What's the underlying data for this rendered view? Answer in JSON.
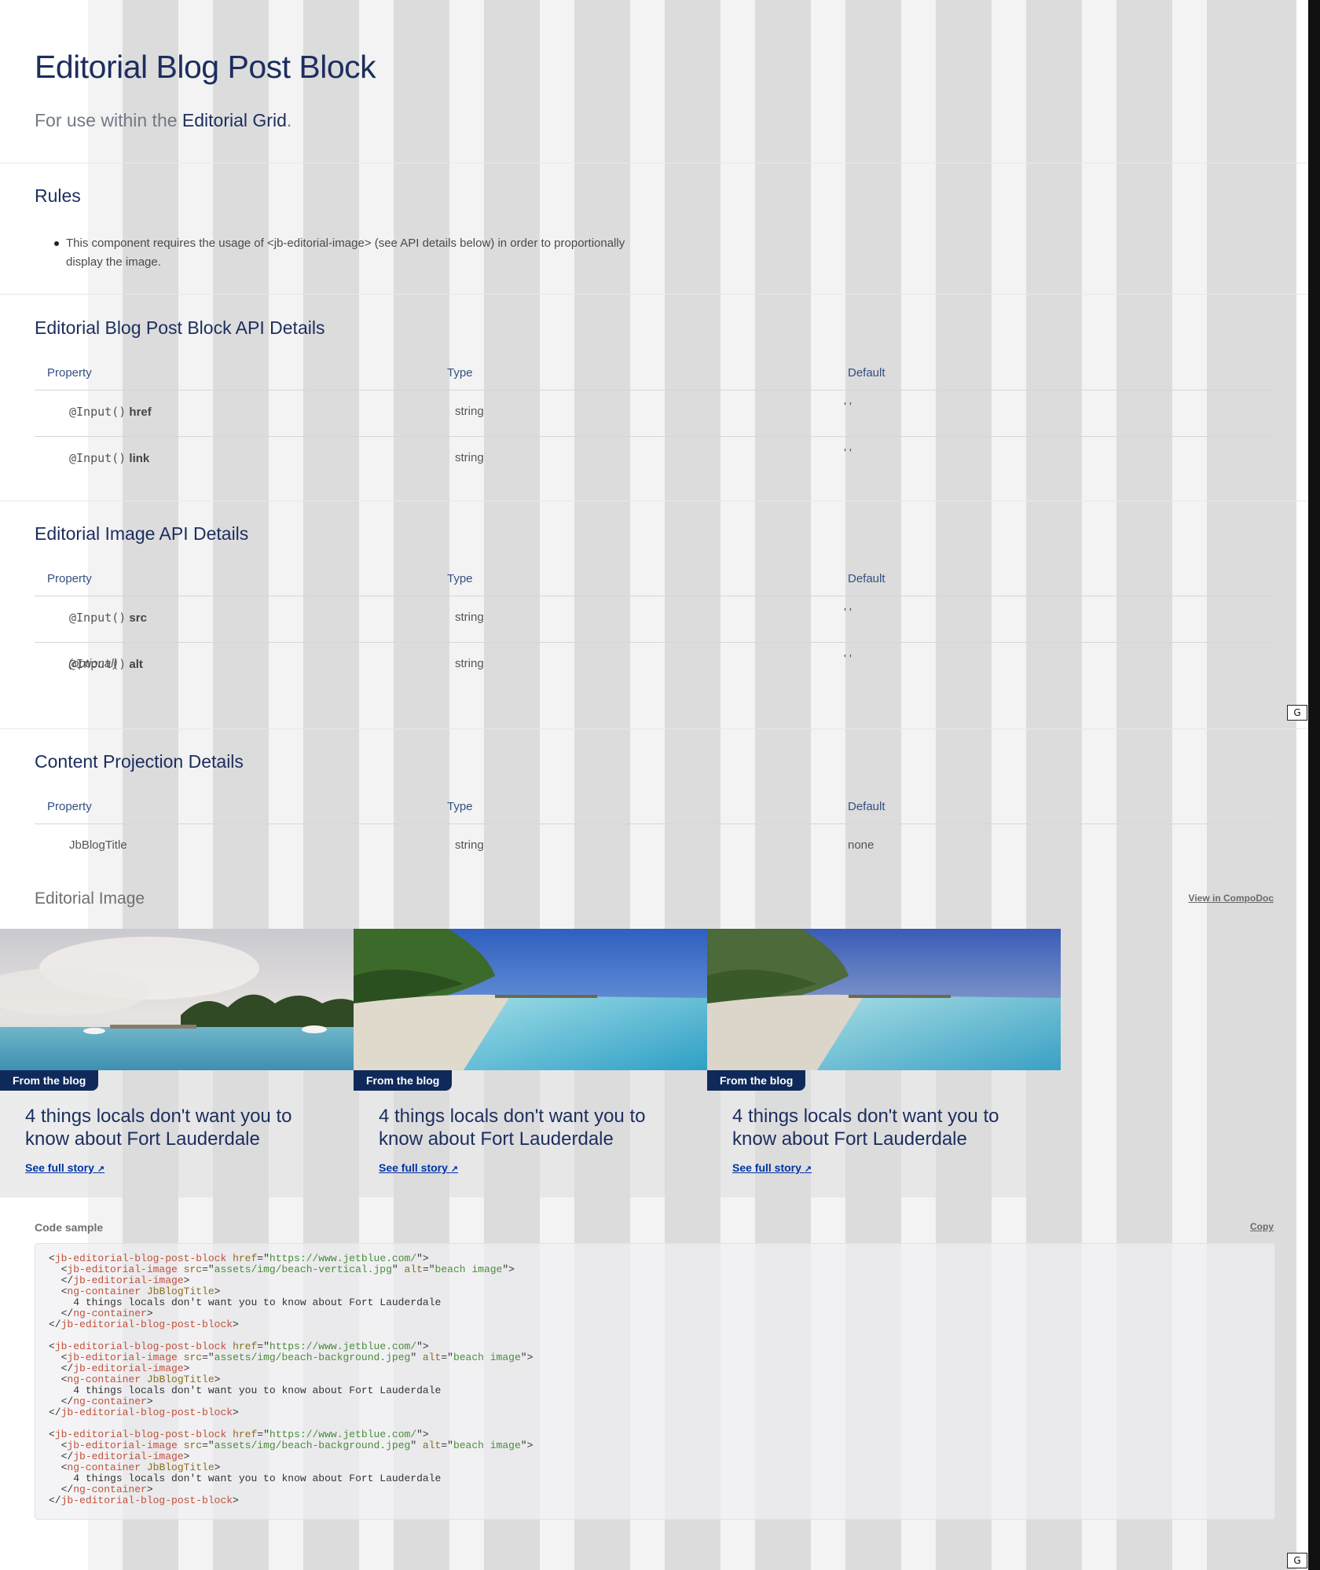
{
  "page": {
    "title": "Editorial Blog Post Block",
    "subtitle_prefix": "For use within the ",
    "subtitle_link": "Editorial Grid",
    "subtitle_suffix": "."
  },
  "rules": {
    "heading": "Rules",
    "items": [
      "This component requires the usage of <jb-editorial-image> (see API details below) in order to proportionally display the image."
    ]
  },
  "table_headers": {
    "property": "Property",
    "type": "Type",
    "default": "Default"
  },
  "blog_api": {
    "heading": "Editorial Blog Post Block API Details",
    "rows": [
      {
        "decorator": "@Input()",
        "name": "href",
        "type": "string",
        "default": "' '"
      },
      {
        "decorator": "@Input()",
        "name": "link",
        "type": "string",
        "default": "' '"
      }
    ]
  },
  "image_api": {
    "heading": "Editorial Image API Details",
    "rows": [
      {
        "decorator": "@Input()",
        "name": "src",
        "type": "string",
        "default": "' '"
      },
      {
        "decorator": "@Input()",
        "name": "alt",
        "note": "(optional)",
        "type": "string",
        "default": "' '"
      }
    ]
  },
  "content_projection": {
    "heading": "Content Projection Details",
    "rows": [
      {
        "name": "JbBlogTitle",
        "type": "string",
        "default": "none"
      }
    ]
  },
  "example": {
    "title": "Editorial Image",
    "compodoc_link": "View in CompoDoc",
    "cards": [
      {
        "badge": "From the blog",
        "title": "4 things locals don't want you to know about Fort Lauderdale",
        "link": "See full story",
        "link_icon": "↗",
        "image": "beach-vertical"
      },
      {
        "badge": "From the blog",
        "title": "4 things locals don't want you to know about Fort Lauderdale",
        "link": "See full story",
        "link_icon": "↗",
        "image": "beach-background"
      },
      {
        "badge": "From the blog",
        "title": "4 things locals don't want you to know about Fort Lauderdale",
        "link": "See full story",
        "link_icon": "↗",
        "image": "beach-background"
      }
    ]
  },
  "code_sample": {
    "label": "Code sample",
    "copy_label": "Copy",
    "blocks": [
      {
        "href": "https://www.jetblue.com/",
        "src": "assets/img/beach-vertical.jpg",
        "alt": "beach image",
        "text": "4 things locals don't want you to know about Fort Lauderdale"
      },
      {
        "href": "https://www.jetblue.com/",
        "src": "assets/img/beach-background.jpeg",
        "alt": "beach image",
        "text": "4 things locals don't want you to know about Fort Lauderdale"
      },
      {
        "href": "https://www.jetblue.com/",
        "src": "assets/img/beach-background.jpeg",
        "alt": "beach image",
        "text": "4 things locals don't want you to know about Fort Lauderdale"
      }
    ]
  },
  "grid_toggle": {
    "label": "G"
  },
  "colors": {
    "heading": "#1c2e5e",
    "badge": "#0f2a5a",
    "link": "#0033a0",
    "grid_column": "#dcdcdc",
    "grid_gutter": "#f3f3f3"
  }
}
